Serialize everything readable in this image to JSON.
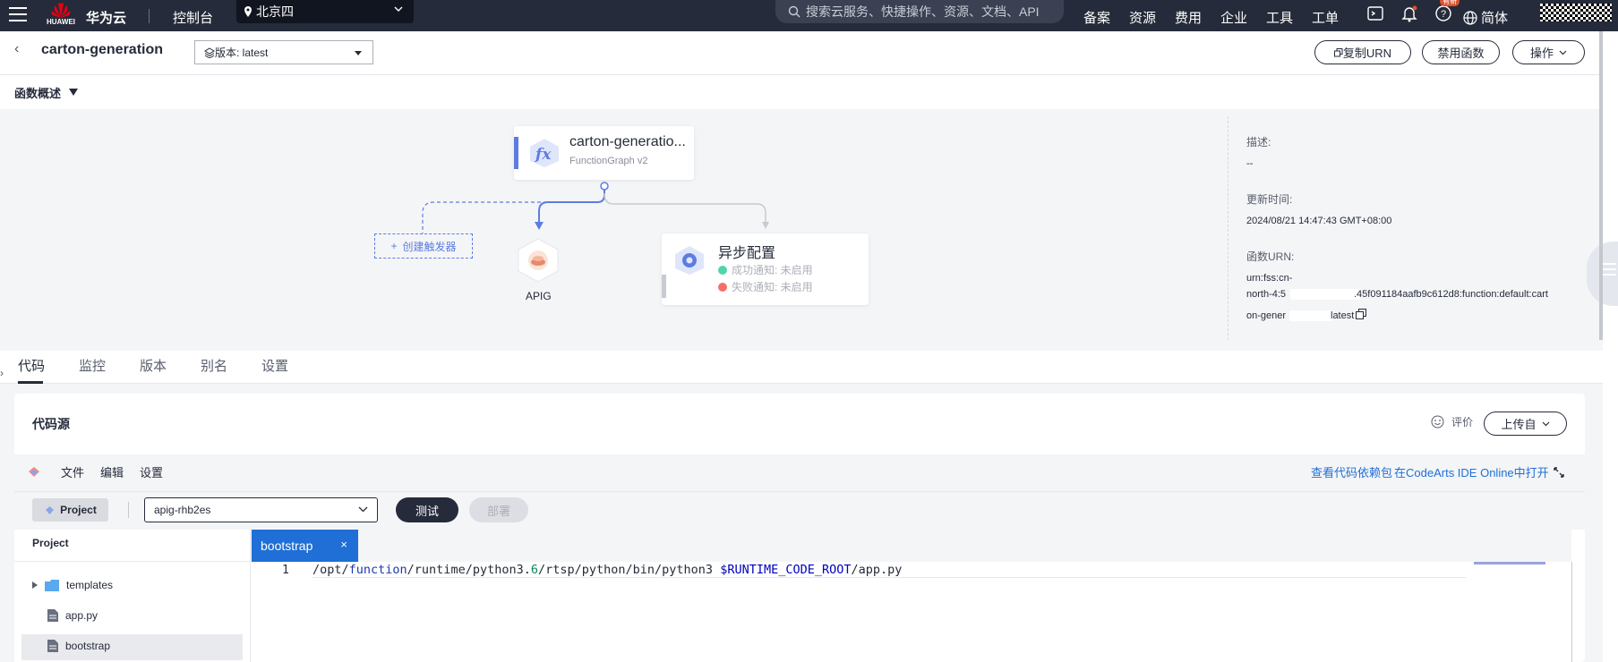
{
  "topnav": {
    "brand": "华为云",
    "logo_text": "HUAWEI",
    "console": "控制台",
    "region": "北京四",
    "search_placeholder": "搜索云服务、快捷操作、资源、文档、API",
    "links": [
      "备案",
      "资源",
      "费用",
      "企业",
      "工具",
      "工单"
    ],
    "badge": "有新",
    "language": "简体"
  },
  "header": {
    "function_name": "carton-generation",
    "version_label": "版本: latest",
    "copy_urn": "复制URN",
    "disable_function": "禁用函数",
    "actions": "操作"
  },
  "overview": {
    "label": "函数概述",
    "function_card": {
      "name": "carton-generatio...",
      "runtime": "FunctionGraph v2"
    },
    "create_trigger": "创建触发器",
    "apig_label": "APIG",
    "async": {
      "title": "异步配置",
      "success": "成功通知: 未启用",
      "failure": "失败通知: 未启用"
    },
    "info": {
      "desc_label": "描述:",
      "desc_value": "--",
      "updated_label": "更新时间:",
      "updated_value": "2024/08/21 14:47:43 GMT+08:00",
      "urn_label": "函数URN:",
      "urn_line1": "urn:fss:cn-",
      "urn_line2a": "north-4:5",
      "urn_line2b": ".45f091184aafb9c612d8:function:default:cart",
      "urn_line3a": "on-gener",
      "urn_line3b": "latest"
    }
  },
  "tabs": [
    "代码",
    "监控",
    "版本",
    "别名",
    "设置"
  ],
  "code_source": {
    "title": "代码源",
    "rating": "评价",
    "upload": "上传自",
    "menu": [
      "文件",
      "编辑",
      "设置"
    ],
    "view_deps": "查看代码依赖包",
    "open_ide": "在CodeArts IDE Online中打开",
    "project_btn": "Project",
    "branch": "apig-rhb2es",
    "test": "测试",
    "deploy": "部署",
    "tree_head": "Project",
    "tree_items": [
      "templates",
      "app.py",
      "bootstrap"
    ],
    "editor_tab": "bootstrap",
    "line_number": "1"
  },
  "colors": {
    "nav_bg": "#252b3a",
    "accent": "#5e7ce0",
    "link": "#1f6fd6",
    "success": "#50d4ab",
    "failure": "#f66f6a"
  }
}
